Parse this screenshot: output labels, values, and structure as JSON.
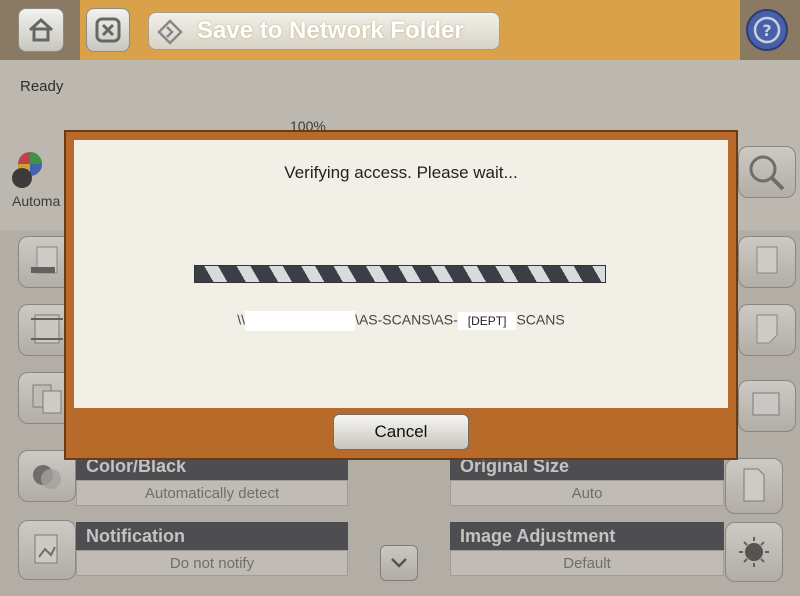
{
  "header": {
    "title": "Save to Network Folder",
    "home_icon": "home-icon",
    "close_icon": "close-icon",
    "folder_icon": "diamond-arrow-icon",
    "help_icon": "help-icon"
  },
  "status": {
    "state": "Ready",
    "zoom": "100%",
    "color_mode_short": "Automa"
  },
  "options": {
    "color": {
      "label": "Color/Black",
      "value": "Automatically detect"
    },
    "original_size": {
      "label": "Original Size",
      "value": "Auto"
    },
    "notification": {
      "label": "Notification",
      "value": "Do not notify"
    },
    "image_adjustment": {
      "label": "Image Adjustment",
      "value": "Default"
    }
  },
  "dialog": {
    "message": "Verifying access.  Please wait...",
    "path_prefix": "\\\\",
    "path_mid": "\\AS-SCANS\\AS-",
    "path_dept": "[DEPT]",
    "path_suffix": "SCANS",
    "cancel_label": "Cancel"
  },
  "colors": {
    "accent": "#d9a24a",
    "dialog_frame": "#b86a2a",
    "panel_header": "#4a4c55",
    "help_button": "#4760a8"
  }
}
